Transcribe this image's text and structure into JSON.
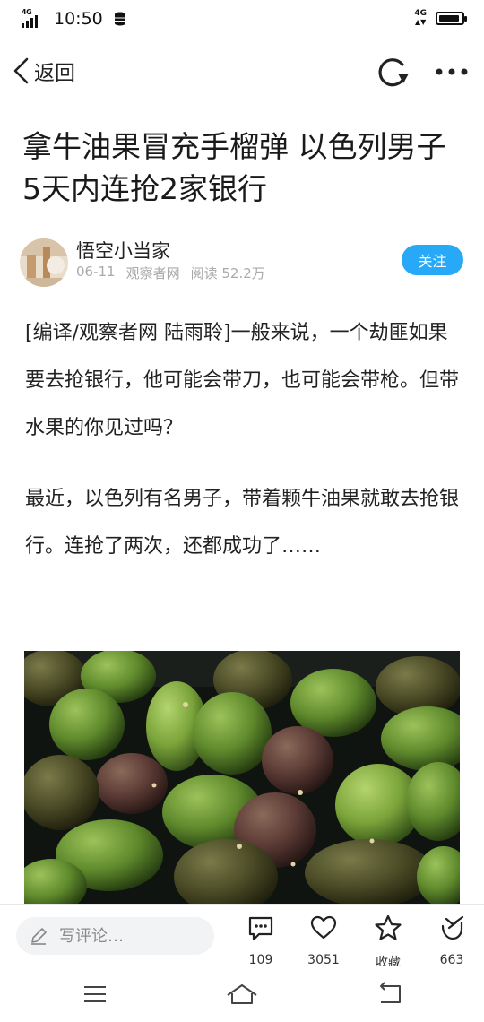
{
  "status_bar": {
    "time": "10:50",
    "network_left": "4G",
    "network_right": "4G",
    "battery_level": 0.9
  },
  "nav": {
    "back_label": "返回"
  },
  "article": {
    "title": "拿牛油果冒充手榴弹 以色列男子5天内连抢2家银行",
    "author": {
      "name": "悟空小当家",
      "date": "06-11",
      "source": "观察者网",
      "reads": "阅读 52.2万",
      "follow_label": "关注"
    },
    "paragraphs": [
      "[编译/观察者网 陆雨聆]一般来说，一个劫匪如果要去抢银行，他可能会带刀，也可能会带枪。但带水果的你见过吗？",
      "最近，以色列有名男子，带着颗牛油果就敢去抢银行。连抢了两次，还都成功了……"
    ]
  },
  "action_bar": {
    "comment_placeholder": "写评论…",
    "comments_count": "109",
    "likes_count": "3051",
    "favorite_label": "收藏",
    "share_count": "663"
  },
  "colors": {
    "accent": "#27a9f7",
    "text": "#222222",
    "meta": "#aaaaaa"
  }
}
